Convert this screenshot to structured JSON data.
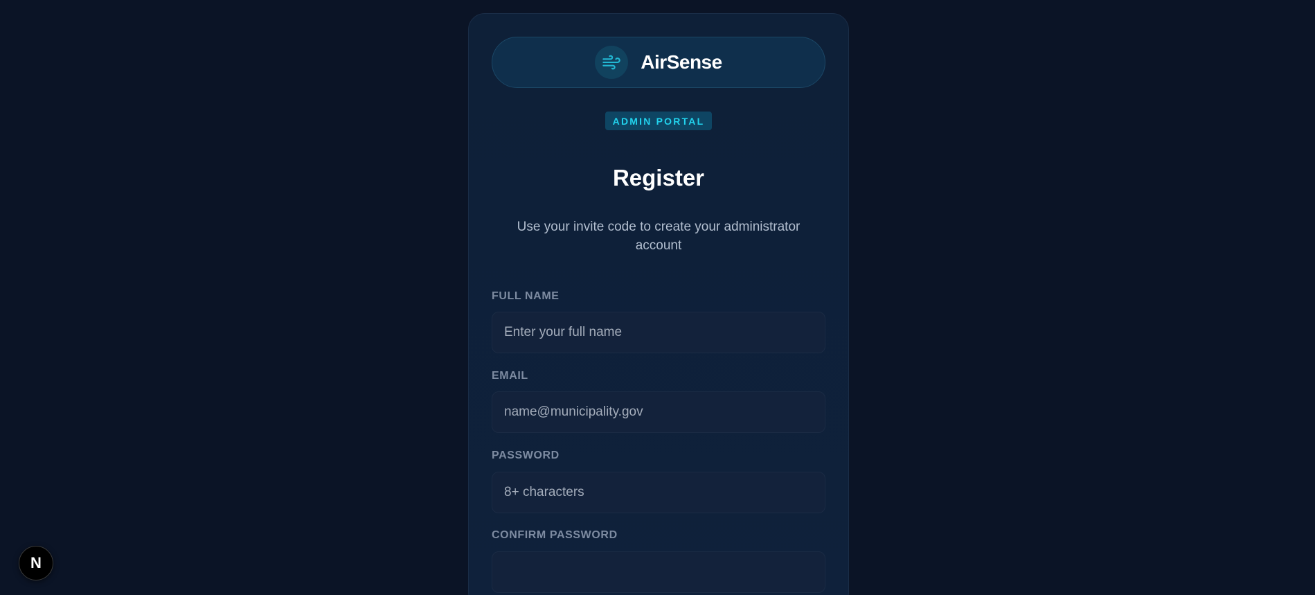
{
  "brand": {
    "name": "AirSense",
    "logo_icon": "wind-icon",
    "accent_color": "#22d3ee"
  },
  "badge": {
    "label": "ADMIN PORTAL"
  },
  "heading": {
    "title": "Register",
    "subtitle": "Use your invite code to create your administrator account"
  },
  "form": {
    "full_name": {
      "label": "FULL NAME",
      "placeholder": "Enter your full name",
      "value": ""
    },
    "email": {
      "label": "EMAIL",
      "placeholder": "name@municipality.gov",
      "value": ""
    },
    "password": {
      "label": "PASSWORD",
      "placeholder": "8+ characters",
      "value": ""
    },
    "confirm_password": {
      "label": "CONFIRM PASSWORD",
      "placeholder": "",
      "value": ""
    }
  },
  "dev_indicator": {
    "label": "N",
    "icon": "nextjs-icon"
  }
}
